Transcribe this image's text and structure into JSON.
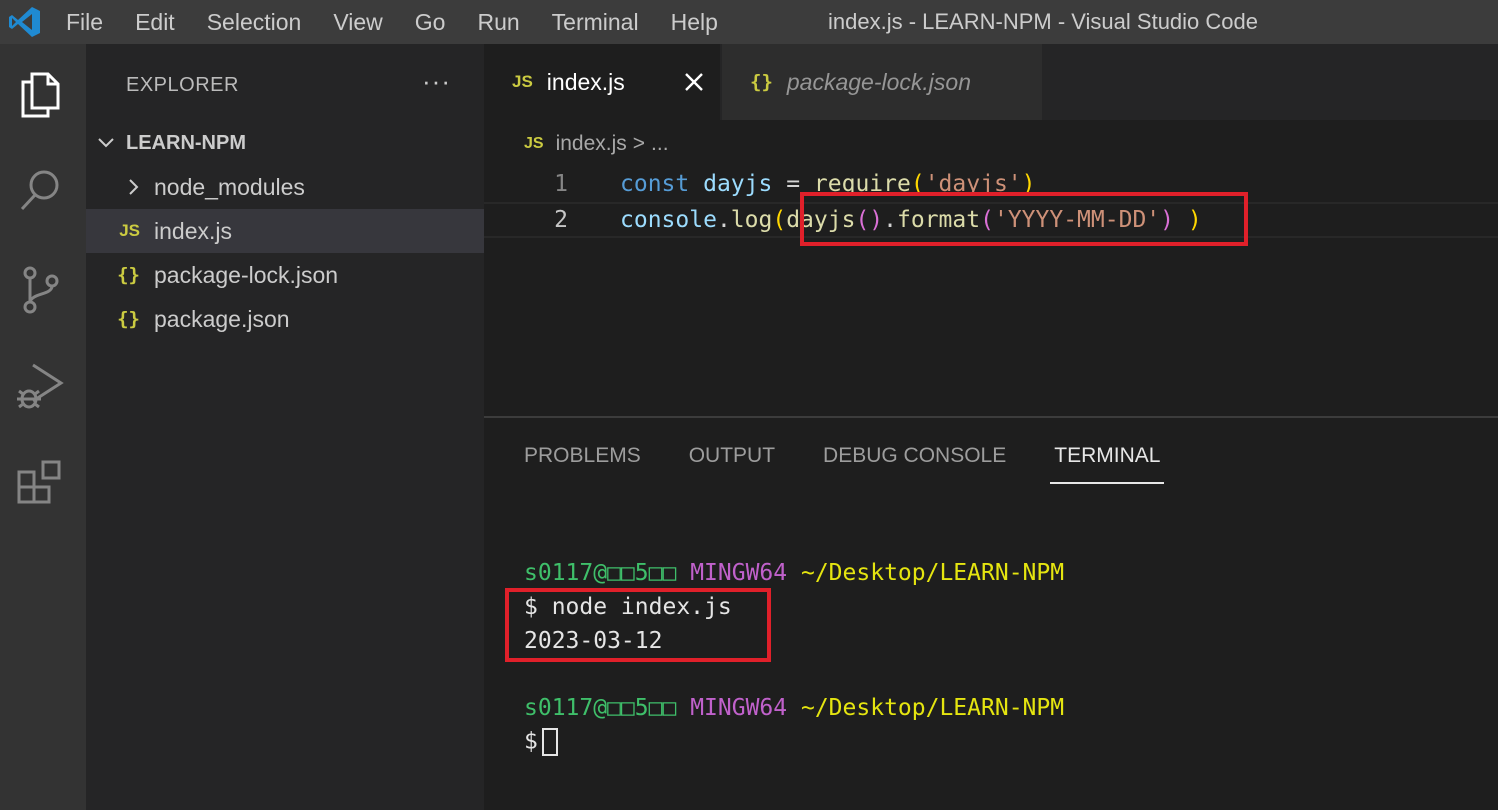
{
  "menubar": {
    "items": [
      "File",
      "Edit",
      "Selection",
      "View",
      "Go",
      "Run",
      "Terminal",
      "Help"
    ],
    "window_title": "index.js - LEARN-NPM - Visual Studio Code"
  },
  "activitybar": {
    "icons": [
      "explorer-icon",
      "search-icon",
      "source-control-icon",
      "run-debug-icon",
      "extensions-icon"
    ]
  },
  "sidebar": {
    "header": "EXPLORER",
    "more": "···",
    "folder": "LEARN-NPM",
    "items": [
      {
        "icon": ">",
        "label": "node_modules"
      },
      {
        "icon": "JS",
        "label": "index.js"
      },
      {
        "icon": "{}",
        "label": "package-lock.json"
      },
      {
        "icon": "{}",
        "label": "package.json"
      }
    ]
  },
  "tabs": [
    {
      "icon": "JS",
      "label": "index.js",
      "active": true
    },
    {
      "icon": "{}",
      "label": "package-lock.json",
      "active": false
    }
  ],
  "breadcrumb": {
    "icon": "JS",
    "file": "index.js",
    "sep": ">",
    "rest": "..."
  },
  "code": {
    "lines": [
      {
        "no": "1",
        "text": "const dayjs = require('dayjs')"
      },
      {
        "no": "2",
        "text": "console.log(dayjs().format('YYYY-MM-DD') )"
      }
    ]
  },
  "panel": {
    "tabs": [
      "PROBLEMS",
      "OUTPUT",
      "DEBUG CONSOLE",
      "TERMINAL"
    ],
    "active_tab": "TERMINAL"
  },
  "terminal": {
    "prompt_user": "s0117@□□5□□",
    "prompt_env": "MINGW64",
    "prompt_path": "~/Desktop/LEARN-NPM",
    "command": "$ node index.js",
    "output": "2023-03-12",
    "prompt2_user": "s0117@□□5□□",
    "prompt2_env": "MINGW64",
    "prompt2_path": "~/Desktop/LEARN-NPM",
    "prompt_symbol": "$"
  },
  "colors": {
    "highlight_box": "#e0202a",
    "accent_blue": "#0078d4"
  }
}
